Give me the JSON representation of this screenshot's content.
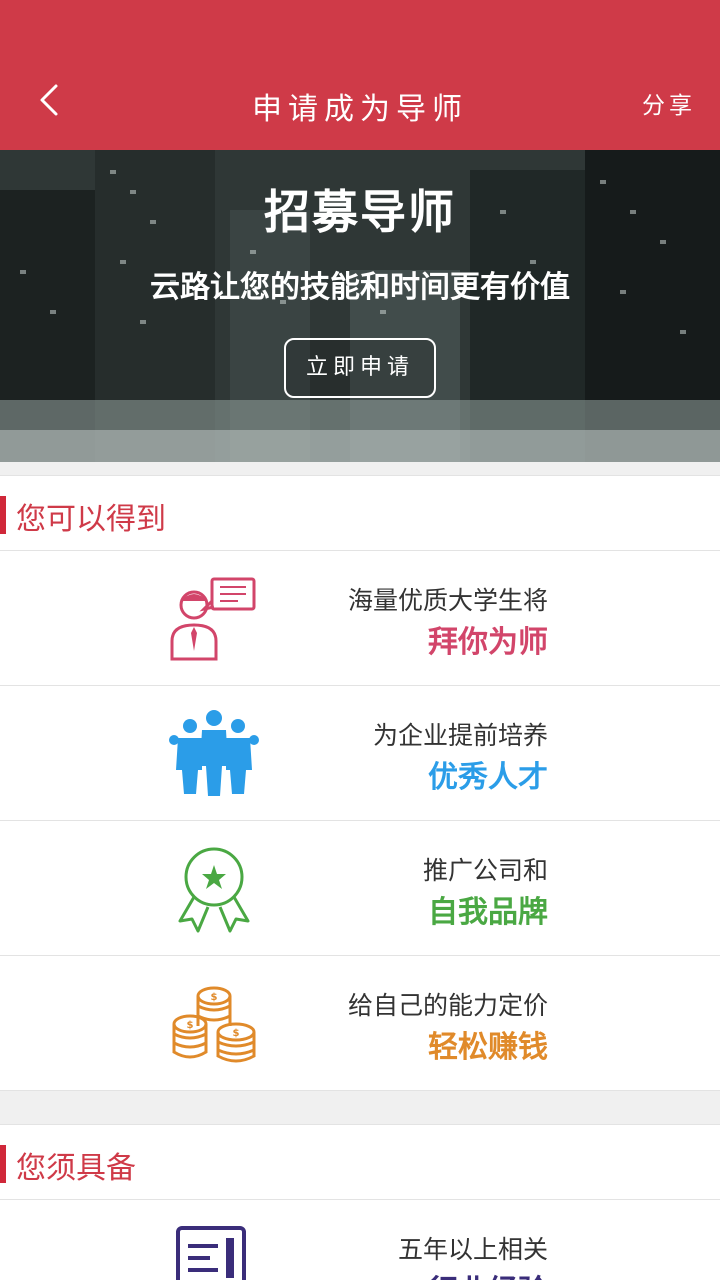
{
  "header": {
    "title": "申请成为导师",
    "share_label": "分享"
  },
  "banner": {
    "title": "招募导师",
    "subtitle": "云路让您的技能和时间更有价值",
    "apply_label": "立即申请"
  },
  "benefits": {
    "heading": "您可以得到",
    "items": [
      {
        "line1": "海量优质大学生将",
        "line2": "拜你为师",
        "icon": "teacher-icon",
        "color": "#d2456a"
      },
      {
        "line1": "为企业提前培养",
        "line2": "优秀人才",
        "icon": "team-icon",
        "color": "#2b9de8"
      },
      {
        "line1": "推广公司和",
        "line2": "自我品牌",
        "icon": "award-badge-icon",
        "color": "#4aa843"
      },
      {
        "line1": "给自己的能力定价",
        "line2": "轻松赚钱",
        "icon": "coins-icon",
        "color": "#e08a2a"
      }
    ]
  },
  "requirements": {
    "heading": "您须具备",
    "items": [
      {
        "line1": "五年以上相关",
        "line2": "行业经验",
        "icon": "document-icon",
        "color": "#3a2d7a"
      }
    ]
  }
}
